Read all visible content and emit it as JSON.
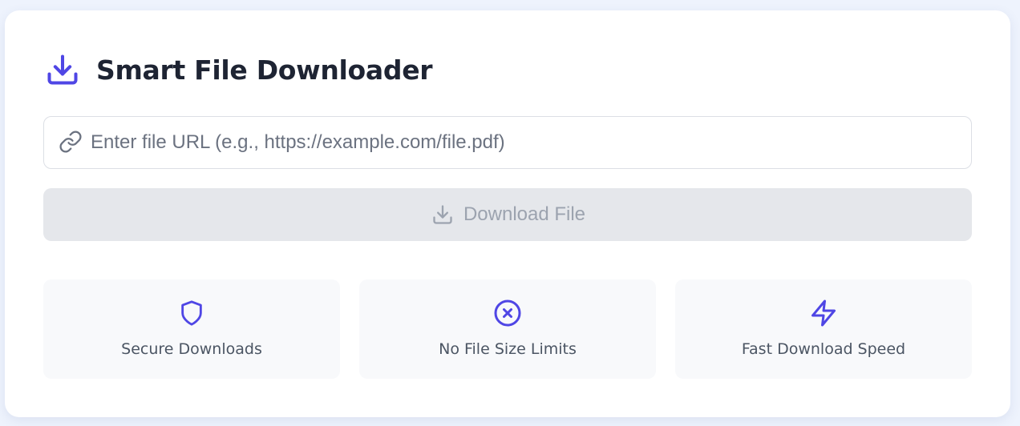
{
  "app": {
    "title": "Smart File Downloader",
    "logo_icon": "download-icon",
    "accent_color": "#4f46e5"
  },
  "url_input": {
    "value": "",
    "placeholder": "Enter file URL (e.g., https://example.com/file.pdf)",
    "icon": "link-icon"
  },
  "download_button": {
    "label": "Download File",
    "icon": "download-icon",
    "disabled": true,
    "background_color": "#e5e7eb",
    "text_color": "#9ca3af"
  },
  "features": [
    {
      "label": "Secure Downloads",
      "icon": "shield-icon"
    },
    {
      "label": "No File Size Limits",
      "icon": "circle-x-icon"
    },
    {
      "label": "Fast Download Speed",
      "icon": "lightning-icon"
    }
  ]
}
